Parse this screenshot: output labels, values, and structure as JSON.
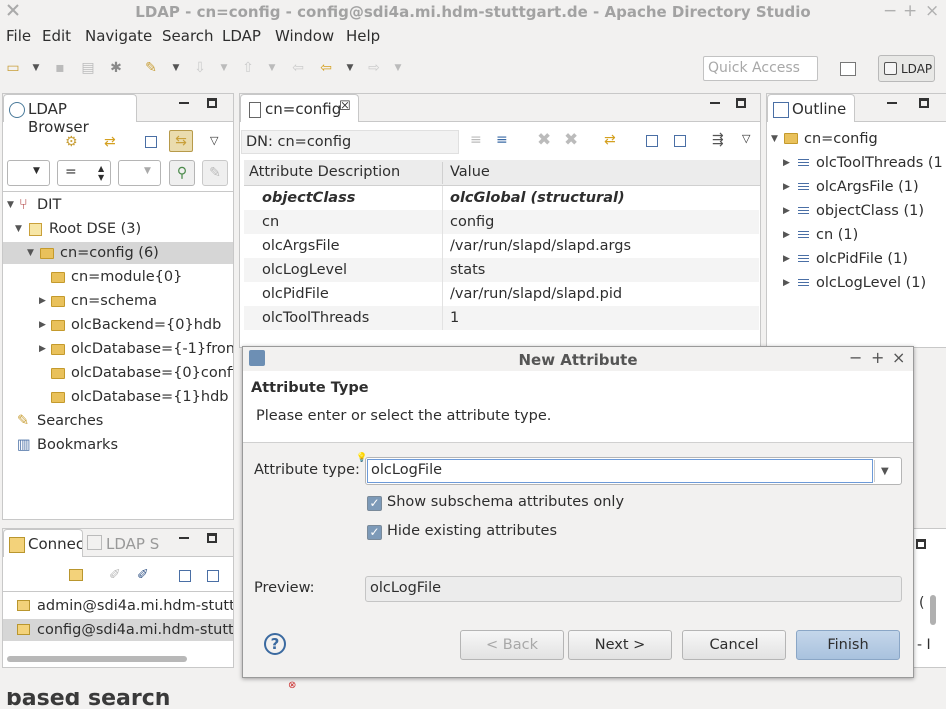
{
  "window": {
    "title": "LDAP - cn=config - config@sdi4a.mi.hdm-stuttgart.de - Apache Directory Studio"
  },
  "menu": [
    "File",
    "Edit",
    "Navigate",
    "Search",
    "LDAP",
    "Window",
    "Help"
  ],
  "toolbar": {
    "quick_access_placeholder": "Quick Access",
    "perspective_label": "LDAP"
  },
  "browser": {
    "tab_label": "LDAP Browser",
    "filter_operator": "=",
    "tree": [
      {
        "label": "DIT"
      },
      {
        "label": "Root DSE (3)"
      },
      {
        "label": "cn=config (6)"
      },
      {
        "label": "cn=module{0}"
      },
      {
        "label": "cn=schema"
      },
      {
        "label": "olcBackend={0}hdb"
      },
      {
        "label": "olcDatabase={-1}fronte"
      },
      {
        "label": "olcDatabase={0}config"
      },
      {
        "label": "olcDatabase={1}hdb"
      },
      {
        "label": "Searches"
      },
      {
        "label": "Bookmarks"
      }
    ]
  },
  "connections": {
    "tab_label": "Connec",
    "tab2_label": "LDAP S",
    "items": [
      "admin@sdi4a.mi.hdm-stuttg",
      "config@sdi4a.mi.hdm-stutt"
    ]
  },
  "editor": {
    "tab_label": "cn=config",
    "dn": "DN: cn=config",
    "columns": [
      "Attribute Description",
      "Value"
    ],
    "rows": [
      {
        "attr": "objectClass",
        "value": "olcGlobal (structural)"
      },
      {
        "attr": "cn",
        "value": "config"
      },
      {
        "attr": "olcArgsFile",
        "value": "/var/run/slapd/slapd.args"
      },
      {
        "attr": "olcLogLevel",
        "value": "stats"
      },
      {
        "attr": "olcPidFile",
        "value": "/var/run/slapd/slapd.pid"
      },
      {
        "attr": "olcToolThreads",
        "value": "1"
      }
    ]
  },
  "outline": {
    "tab_label": "Outline",
    "root": "cn=config",
    "items": [
      "olcToolThreads (1",
      "olcArgsFile (1)",
      "objectClass (1)",
      "cn (1)",
      "olcPidFile (1)",
      "olcLogLevel (1)"
    ]
  },
  "dialog": {
    "title": "New Attribute",
    "heading": "Attribute Type",
    "description": "Please enter or select the attribute type.",
    "type_label": "Attribute type:",
    "type_value": "olcLogFile",
    "check1": "Show subschema attributes only",
    "check2": "Hide existing attributes",
    "preview_label": "Preview:",
    "preview_value": "olcLogFile",
    "help": "?",
    "back": "< Back",
    "next": "Next >",
    "cancel": "Cancel",
    "finish": "Finish"
  },
  "background": {
    "partial_text": "based search",
    "right_partial_1": "(",
    "right_partial_2": "- I"
  }
}
